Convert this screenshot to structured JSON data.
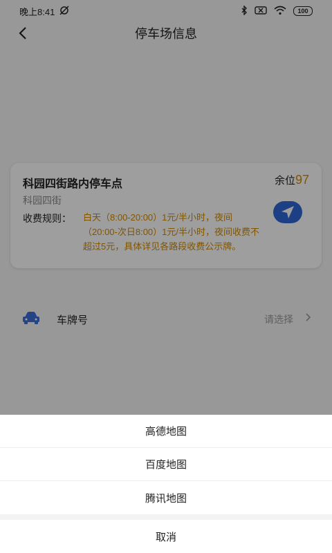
{
  "status_bar": {
    "time": "晚上8:41",
    "battery": "100",
    "icons": [
      "sync-off-icon",
      "bluetooth-icon",
      "sim-icon",
      "wifi-icon",
      "battery-icon"
    ]
  },
  "header": {
    "title": "停车场信息"
  },
  "parking": {
    "name": "科园四街路内停车点",
    "spaces_label": "余位",
    "spaces_count": "97",
    "address": "科园四街",
    "rule_label": "收费规则：",
    "rule_text": "白天（8:00-20:00）1元/半小时，夜间（20:00-次日8:00）1元/半小时，夜间收费不超过5元，具体详见各路段收费公示牌。"
  },
  "plate": {
    "label": "车牌号",
    "placeholder": "请选择"
  },
  "map_sheet": {
    "options": [
      "高德地图",
      "百度地图",
      "腾讯地图"
    ],
    "cancel": "取消"
  },
  "colors": {
    "accent_orange": "#d18a00",
    "nav_blue": "#2f67d6",
    "car_blue": "#3b6fd8"
  }
}
